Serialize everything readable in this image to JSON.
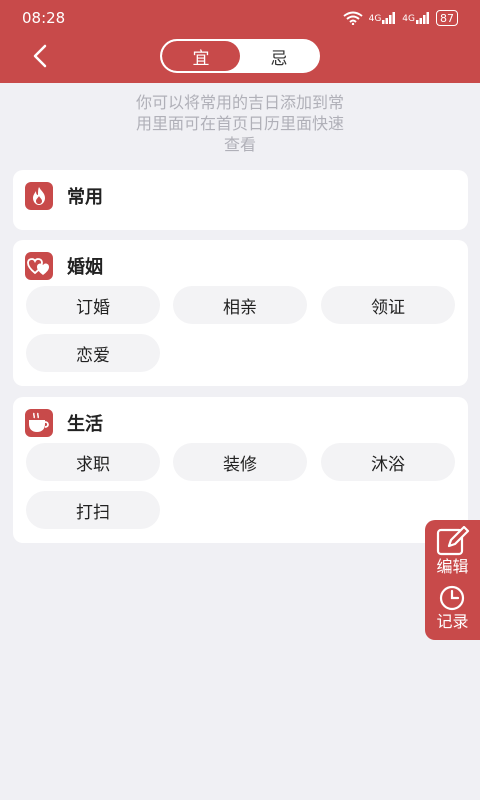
{
  "status": {
    "time": "08:28",
    "signal1": "4G",
    "signal2": "4G",
    "battery": "87"
  },
  "header": {
    "tabs": [
      {
        "label": "宜",
        "active": true
      },
      {
        "label": "忌",
        "active": false
      }
    ]
  },
  "hint": {
    "line1": "你可以将常用的吉日添加到常",
    "line2": "用里面可在首页日历里面快速",
    "line3": "查看"
  },
  "sections": [
    {
      "title": "常用",
      "icon": "flame-icon",
      "items": []
    },
    {
      "title": "婚姻",
      "icon": "hearts-icon",
      "items": [
        "订婚",
        "相亲",
        "领证",
        "恋爱"
      ]
    },
    {
      "title": "生活",
      "icon": "cup-icon",
      "items": [
        "求职",
        "装修",
        "沐浴",
        "打扫"
      ]
    }
  ],
  "side": {
    "edit_label": "编辑",
    "history_label": "记录"
  },
  "colors": {
    "accent": "#c84a4a",
    "background": "#f0f0f4",
    "chip": "#f3f3f5"
  }
}
